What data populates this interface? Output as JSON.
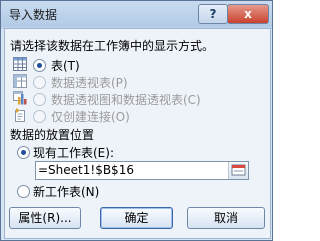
{
  "window": {
    "title": "导入数据",
    "help_label": "?",
    "close_label": "x"
  },
  "display": {
    "prompt": "请选择该数据在工作簿中的显示方式。",
    "options": [
      {
        "label": "表(T)",
        "icon": "table-icon",
        "checked": true,
        "enabled": true
      },
      {
        "label": "数据透视表(P)",
        "icon": "pivot-table-icon",
        "checked": false,
        "enabled": false
      },
      {
        "label": "数据透视图和数据透视表(C)",
        "icon": "pivot-chart-icon",
        "checked": false,
        "enabled": false
      },
      {
        "label": "仅创建连接(O)",
        "icon": "connection-icon",
        "checked": false,
        "enabled": false
      }
    ]
  },
  "placement": {
    "heading": "数据的放置位置",
    "existing_label": "现有工作表(E):",
    "existing_checked": true,
    "range_value": "=Sheet1!$B$16",
    "new_sheet_label": "新工作表(N)",
    "new_sheet_checked": false
  },
  "buttons": {
    "properties": "属性(R)...",
    "ok": "确定",
    "cancel": "取消"
  }
}
